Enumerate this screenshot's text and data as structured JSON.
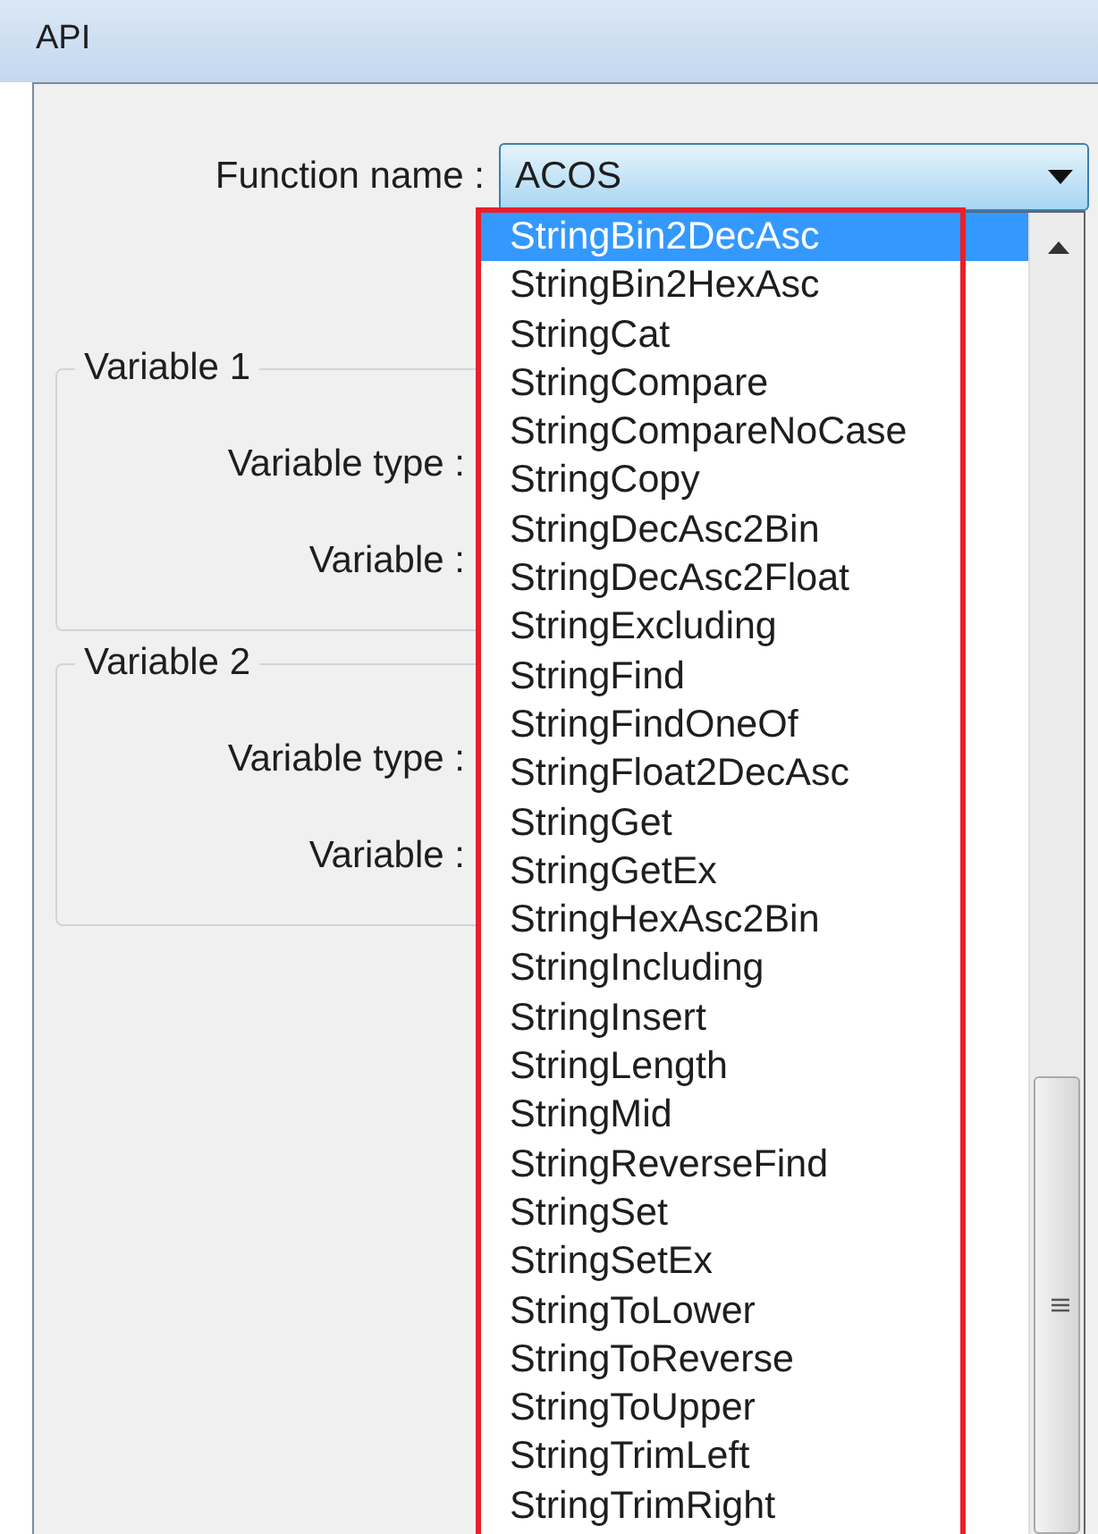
{
  "window": {
    "title": "API"
  },
  "function_name": {
    "label": "Function name :",
    "value": "ACOS"
  },
  "dropdown": {
    "items": [
      {
        "label": "StringBin2DecAsc",
        "selected": true
      },
      {
        "label": "StringBin2HexAsc",
        "selected": false
      },
      {
        "label": "StringCat",
        "selected": false
      },
      {
        "label": "StringCompare",
        "selected": false
      },
      {
        "label": "StringCompareNoCase",
        "selected": false
      },
      {
        "label": "StringCopy",
        "selected": false
      },
      {
        "label": "StringDecAsc2Bin",
        "selected": false
      },
      {
        "label": "StringDecAsc2Float",
        "selected": false
      },
      {
        "label": "StringExcluding",
        "selected": false
      },
      {
        "label": "StringFind",
        "selected": false
      },
      {
        "label": "StringFindOneOf",
        "selected": false
      },
      {
        "label": "StringFloat2DecAsc",
        "selected": false
      },
      {
        "label": "StringGet",
        "selected": false
      },
      {
        "label": "StringGetEx",
        "selected": false
      },
      {
        "label": "StringHexAsc2Bin",
        "selected": false
      },
      {
        "label": "StringIncluding",
        "selected": false
      },
      {
        "label": "StringInsert",
        "selected": false
      },
      {
        "label": "StringLength",
        "selected": false
      },
      {
        "label": "StringMid",
        "selected": false
      },
      {
        "label": "StringReverseFind",
        "selected": false
      },
      {
        "label": "StringSet",
        "selected": false
      },
      {
        "label": "StringSetEx",
        "selected": false
      },
      {
        "label": "StringToLower",
        "selected": false
      },
      {
        "label": "StringToReverse",
        "selected": false
      },
      {
        "label": "StringToUpper",
        "selected": false
      },
      {
        "label": "StringTrimLeft",
        "selected": false
      },
      {
        "label": "StringTrimRight",
        "selected": false
      }
    ]
  },
  "groups": [
    {
      "title": "Variable 1",
      "fields": [
        "Variable type :",
        "Variable :"
      ]
    },
    {
      "title": "Variable 2",
      "fields": [
        "Variable type :",
        "Variable :"
      ]
    }
  ]
}
